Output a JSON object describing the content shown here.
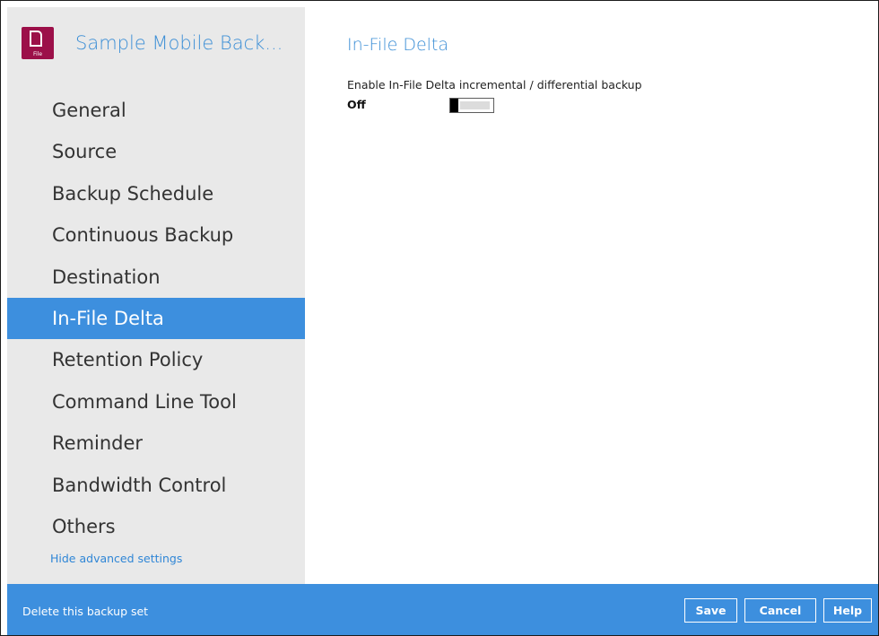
{
  "app": {
    "title": "Sample Mobile Back...",
    "icon_name": "file-document-icon",
    "icon_tag": "File",
    "icon_color": "#9c1049"
  },
  "sidebar": {
    "items": [
      {
        "label": "General",
        "active": false
      },
      {
        "label": "Source",
        "active": false
      },
      {
        "label": "Backup Schedule",
        "active": false
      },
      {
        "label": "Continuous Backup",
        "active": false
      },
      {
        "label": "Destination",
        "active": false
      },
      {
        "label": "In-File Delta",
        "active": true
      },
      {
        "label": "Retention Policy",
        "active": false
      },
      {
        "label": "Command Line Tool",
        "active": false
      },
      {
        "label": "Reminder",
        "active": false
      },
      {
        "label": "Bandwidth Control",
        "active": false
      },
      {
        "label": "Others",
        "active": false
      }
    ],
    "hide_advanced_label": "Hide advanced settings"
  },
  "main": {
    "title": "In-File Delta",
    "setting_label": "Enable In-File Delta incremental / differential backup",
    "toggle_state_label": "Off",
    "toggle_on": false
  },
  "footer": {
    "delete_label": "Delete this backup set",
    "save_label": "Save",
    "cancel_label": "Cancel",
    "help_label": "Help"
  },
  "colors": {
    "accent": "#3d8fde",
    "sidebar_bg": "#e9e9e9",
    "title_blue": "#3d8fd6"
  }
}
